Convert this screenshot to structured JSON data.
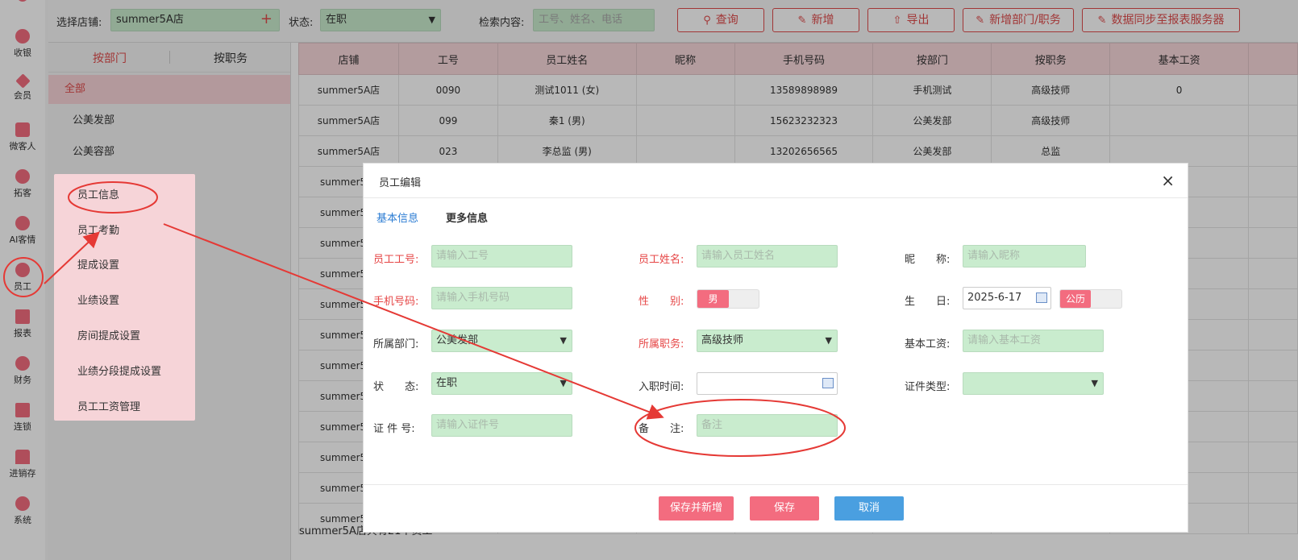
{
  "sidebar": {
    "items": [
      {
        "label": "收银",
        "icon": "cash-icon"
      },
      {
        "label": "会员",
        "icon": "diamond-icon"
      },
      {
        "label": "微客人",
        "icon": "grid-icon"
      },
      {
        "label": "拓客",
        "icon": "people-icon"
      },
      {
        "label": "AI客情",
        "icon": "play-icon"
      },
      {
        "label": "员工",
        "icon": "user-icon"
      },
      {
        "label": "报表",
        "icon": "monitor-icon"
      },
      {
        "label": "财务",
        "icon": "pie-icon"
      },
      {
        "label": "连锁",
        "icon": "store-icon"
      },
      {
        "label": "进销存",
        "icon": "warehouse-icon"
      },
      {
        "label": "系统",
        "icon": "gear-icon"
      }
    ]
  },
  "toolbar": {
    "store_label": "选择店铺:",
    "store_value": "summer5A店",
    "status_label": "状态:",
    "status_value": "在职",
    "search_label": "检索内容:",
    "search_placeholder": "工号、姓名、电话",
    "buttons": [
      "查询",
      "新增",
      "导出",
      "新增部门/职务",
      "数据同步至报表服务器"
    ]
  },
  "dept_panel": {
    "tabs": [
      "按部门",
      "按职务"
    ],
    "items": [
      "全部",
      "公美发部",
      "公美容部"
    ]
  },
  "table": {
    "headers": [
      "店铺",
      "工号",
      "员工姓名",
      "昵称",
      "手机号码",
      "按部门",
      "按职务",
      "基本工资"
    ],
    "rows": [
      [
        "summer5A店",
        "0090",
        "测试1011 (女)",
        "",
        "13589898989",
        "手机测试",
        "高级技师",
        "0"
      ],
      [
        "summer5A店",
        "099",
        "秦1 (男)",
        "",
        "15623232323",
        "公美发部",
        "高级技师",
        ""
      ],
      [
        "summer5A店",
        "023",
        "李总监 (男)",
        "",
        "13202656565",
        "公美发部",
        "总监",
        ""
      ]
    ],
    "partial_store": "summer5",
    "footer": "summer5A店共有21个员工"
  },
  "popup_menu": {
    "items": [
      "员工信息",
      "员工考勤",
      "提成设置",
      "业绩设置",
      "房间提成设置",
      "业绩分段提成设置",
      "员工工资管理"
    ]
  },
  "dialog": {
    "title": "员工编辑",
    "close": "×",
    "tabs": [
      "基本信息",
      "更多信息"
    ],
    "fields": {
      "emp_no_label": "员工工号:",
      "emp_no_ph": "请输入工号",
      "name_label": "员工姓名:",
      "name_ph": "请输入员工姓名",
      "nick_label": "昵　　称:",
      "nick_ph": "请输入昵称",
      "phone_label": "手机号码:",
      "phone_ph": "请输入手机号码",
      "gender_label": "性　　别:",
      "gender_value": "男",
      "birthday_label": "生　　日:",
      "birthday_value": "2025-6-17",
      "calendar_value": "公历",
      "dept_label": "所属部门:",
      "dept_value": "公美发部",
      "position_label": "所属职务:",
      "position_value": "高级技师",
      "salary_label": "基本工资:",
      "salary_ph": "请输入基本工资",
      "status_label": "状　　态:",
      "status_value": "在职",
      "hire_label": "入职时间:",
      "id_type_label": "证件类型:",
      "id_no_label": "证 件 号:",
      "id_no_ph": "请输入证件号",
      "remark_label": "备　　注:",
      "remark_ph": "备注"
    },
    "buttons": {
      "save_new": "保存并新增",
      "save": "保存",
      "cancel": "取消"
    }
  },
  "colors": {
    "accent": "#f36c7f",
    "field_bg": "#c9ecce",
    "cancel_btn": "#4a9fe0",
    "annotation": "#e53935"
  }
}
